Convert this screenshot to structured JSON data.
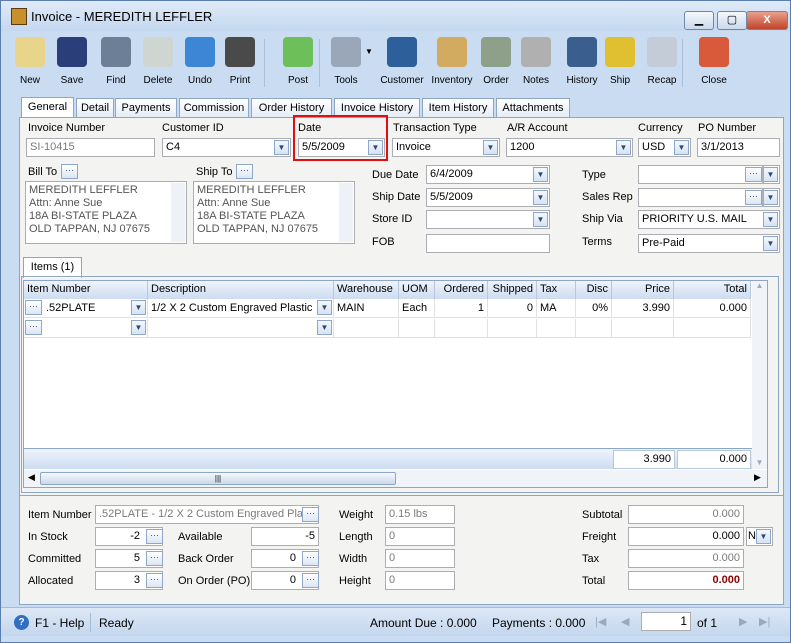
{
  "window": {
    "title": "Invoice - MEREDITH LEFFLER",
    "minimize": "▁",
    "maximize": "▢",
    "close": "X"
  },
  "toolbar": [
    {
      "label": "New",
      "icon": "new-document-icon",
      "color": "#e8d58a"
    },
    {
      "label": "Save",
      "icon": "floppy-disk-icon",
      "color": "#2a3f7a"
    },
    {
      "label": "Find",
      "icon": "binoculars-icon",
      "color": "#6c7f96"
    },
    {
      "label": "Delete",
      "icon": "recycle-bin-icon",
      "color": "#cfd6d2"
    },
    {
      "label": "Undo",
      "icon": "undo-arrow-icon",
      "color": "#3d86d6"
    },
    {
      "label": "Print",
      "icon": "printer-icon",
      "color": "#4a4a4a"
    },
    {
      "label": "Post",
      "icon": "post-check-icon",
      "color": "#6dbf5a"
    },
    {
      "label": "Tools",
      "icon": "tools-icon",
      "color": "#9aa7b8"
    },
    {
      "label": "Customer",
      "icon": "customer-person-icon",
      "color": "#2d5f9a"
    },
    {
      "label": "Inventory",
      "icon": "boxes-icon",
      "color": "#d2aa60"
    },
    {
      "label": "Order",
      "icon": "phone-order-icon",
      "color": "#8ea08a"
    },
    {
      "label": "Notes",
      "icon": "notepad-icon",
      "color": "#b0b0b0"
    },
    {
      "label": "History",
      "icon": "history-hourglass-icon",
      "color": "#3a5f8f"
    },
    {
      "label": "Ship",
      "icon": "forklift-icon",
      "color": "#e0c030"
    },
    {
      "label": "Recap",
      "icon": "recap-report-icon",
      "color": "#c4ccd8"
    },
    {
      "label": "Close",
      "icon": "close-window-icon",
      "color": "#d85a3a"
    }
  ],
  "tabs": [
    "General",
    "Detail",
    "Payments",
    "Commission",
    "Order History",
    "Invoice History",
    "Item History",
    "Attachments"
  ],
  "active_tab": "General",
  "form": {
    "invoice_number": {
      "label": "Invoice Number",
      "value": "SI-10415"
    },
    "customer_id": {
      "label": "Customer ID",
      "value": "C4"
    },
    "date": {
      "label": "Date",
      "value": "5/5/2009",
      "highlight": "#e01010"
    },
    "transaction_type": {
      "label": "Transaction Type",
      "value": "Invoice"
    },
    "ar_account": {
      "label": "A/R Account",
      "value": "1200"
    },
    "currency": {
      "label": "Currency",
      "value": "USD"
    },
    "po_number": {
      "label": "PO Number",
      "value": "3/1/2013"
    },
    "bill_to": {
      "label": "Bill To",
      "lines": [
        "MEREDITH LEFFLER",
        "Attn: Anne Sue",
        "18A BI-STATE PLAZA",
        "OLD TAPPAN, NJ 07675"
      ]
    },
    "ship_to": {
      "label": "Ship To",
      "lines": [
        "MEREDITH LEFFLER",
        "Attn: Anne Sue",
        "18A BI-STATE PLAZA",
        "OLD TAPPAN, NJ 07675"
      ]
    },
    "due_date": {
      "label": "Due Date",
      "value": "6/4/2009"
    },
    "ship_date": {
      "label": "Ship Date",
      "value": "5/5/2009"
    },
    "store_id": {
      "label": "Store ID",
      "value": ""
    },
    "fob": {
      "label": "FOB",
      "value": ""
    },
    "type": {
      "label": "Type",
      "value": ""
    },
    "sales_rep": {
      "label": "Sales Rep",
      "value": ""
    },
    "ship_via": {
      "label": "Ship Via",
      "value": "PRIORITY U.S. MAIL"
    },
    "terms": {
      "label": "Terms",
      "value": "Pre-Paid"
    }
  },
  "items_tab": "Items (1)",
  "grid": {
    "columns": [
      "Item Number",
      "Description",
      "Warehouse",
      "UOM",
      "Ordered",
      "Shipped",
      "Tax",
      "Disc",
      "Price",
      "Total"
    ],
    "rows": [
      [
        ".52PLATE",
        "1/2  X  2  Custom Engraved Plastic",
        "MAIN",
        "Each",
        "1",
        "0",
        "MA",
        "0%",
        "3.990",
        "0.000"
      ]
    ],
    "footer": {
      "price": "3.990",
      "total": "0.000"
    }
  },
  "detail": {
    "item_number": {
      "label": "Item Number",
      "value": ".52PLATE - 1/2  X  2  Custom Engraved Pla"
    },
    "in_stock": {
      "label": "In Stock",
      "value": "-2"
    },
    "committed": {
      "label": "Committed",
      "value": "5"
    },
    "allocated": {
      "label": "Allocated",
      "value": "3"
    },
    "available": {
      "label": "Available",
      "value": "-5"
    },
    "back_order": {
      "label": "Back Order",
      "value": "0"
    },
    "on_order": {
      "label": "On Order (PO)",
      "value": "0"
    },
    "weight": {
      "label": "Weight",
      "value": "0.15 lbs"
    },
    "length": {
      "label": "Length",
      "value": "0"
    },
    "width": {
      "label": "Width",
      "value": "0"
    },
    "height": {
      "label": "Height",
      "value": "0"
    },
    "subtotal": {
      "label": "Subtotal",
      "value": "0.000"
    },
    "freight": {
      "label": "Freight",
      "value": "0.000",
      "option": "N"
    },
    "tax": {
      "label": "Tax",
      "value": "0.000"
    },
    "total": {
      "label": "Total",
      "value": "0.000",
      "color": "#8b0000"
    }
  },
  "status": {
    "help": "F1 - Help",
    "state": "Ready",
    "amount_due": "Amount Due : 0.000",
    "payments": "Payments : 0.000",
    "page": "1",
    "of": "of 1"
  }
}
